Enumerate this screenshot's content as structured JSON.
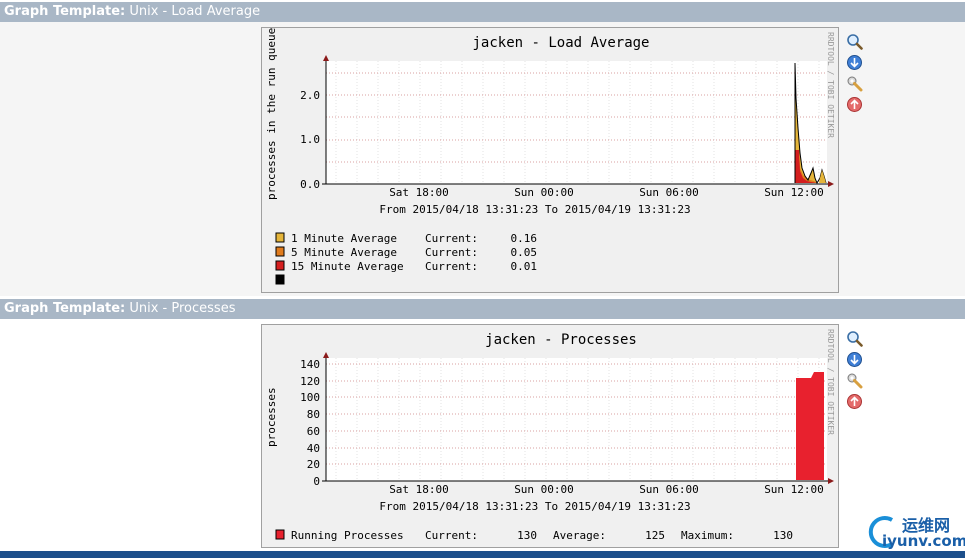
{
  "sections": [
    {
      "prefix": "Graph Template:",
      "name": "Unix - Load Average"
    },
    {
      "prefix": "Graph Template:",
      "name": "Unix - Processes"
    }
  ],
  "load_graph": {
    "title": "jacken - Load Average",
    "ylabel": "processes in the run queue",
    "yticks": [
      "2.0",
      "1.0",
      "0.0"
    ],
    "xticks": [
      "Sat 18:00",
      "Sun 00:00",
      "Sun 06:00",
      "Sun 12:00"
    ],
    "range": "From 2015/04/18 13:31:23 To 2015/04/19 13:31:23",
    "watermark": "RRDTOOL / TOBI OETIKER",
    "legend": [
      {
        "label": "1 Minute Average",
        "current_label": "Current:",
        "current": "0.16",
        "color": "#e5b53a"
      },
      {
        "label": "5 Minute Average",
        "current_label": "Current:",
        "current": "0.05",
        "color": "#e07b1c"
      },
      {
        "label": "15 Minute Average",
        "current_label": "Current:",
        "current": "0.01",
        "color": "#d41e1e"
      },
      {
        "label": "",
        "current_label": "",
        "current": "",
        "color": "#000000"
      }
    ]
  },
  "proc_graph": {
    "title": "jacken - Processes",
    "ylabel": "processes",
    "yticks": [
      "140",
      "120",
      "100",
      "80",
      "60",
      "40",
      "20",
      "0"
    ],
    "xticks": [
      "Sat 18:00",
      "Sun 00:00",
      "Sun 06:00",
      "Sun 12:00"
    ],
    "range": "From 2015/04/18 13:31:23 To 2015/04/19 13:31:23",
    "watermark": "RRDTOOL / TOBI OETIKER",
    "legend": {
      "label": "Running Processes",
      "current_label": "Current:",
      "current": "130",
      "average_label": "Average:",
      "average": "125",
      "maximum_label": "Maximum:",
      "maximum": "130",
      "color": "#e8212e"
    }
  },
  "icons": [
    "zoom-icon",
    "download-icon",
    "edit-properties-icon",
    "move-up-icon"
  ],
  "site_watermark": {
    "cn": "运维网",
    "url": "iyunv.com"
  }
}
